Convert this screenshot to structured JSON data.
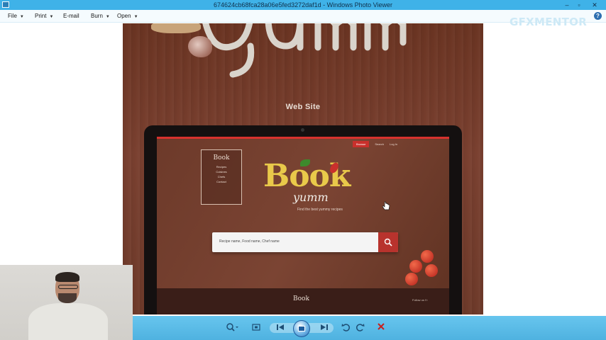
{
  "window": {
    "title": "674624cb68fca28a06e5fed3272daf1d - Windows Photo Viewer",
    "min_label": "–",
    "max_label": "▫",
    "close_label": "✕"
  },
  "menu": {
    "items": [
      {
        "label": "File",
        "has_caret": true
      },
      {
        "label": "Print",
        "has_caret": true
      },
      {
        "label": "E-mail",
        "has_caret": false
      },
      {
        "label": "Burn",
        "has_caret": true
      },
      {
        "label": "Open",
        "has_caret": true
      }
    ],
    "help_label": "?"
  },
  "watermark": "GFXMENTOR",
  "image": {
    "heading": "Web Site",
    "site": {
      "nav": [
        "Browse",
        "Search",
        "Log In"
      ],
      "card_title": "Book",
      "card_items": [
        "Recipes",
        "Cuisines",
        "Chefs",
        "Contact"
      ],
      "logo_main": "Book",
      "logo_sub": "yumm",
      "tagline": "Find the best yummy recipes",
      "search_placeholder": "Recipe name, Food name, Chef name",
      "footer_logo": "Book",
      "footer_social": "Follow us  f  t"
    },
    "accent_color": "#c9302c"
  },
  "toolbar": {
    "zoom_icon": "magnifier-icon",
    "actual_size_icon": "actual-size-icon",
    "prev_icon": "previous-icon",
    "slideshow_icon": "slideshow-icon",
    "next_icon": "next-icon",
    "rotate_ccw_icon": "rotate-left-icon",
    "rotate_cw_icon": "rotate-right-icon",
    "delete_icon": "delete-icon"
  }
}
